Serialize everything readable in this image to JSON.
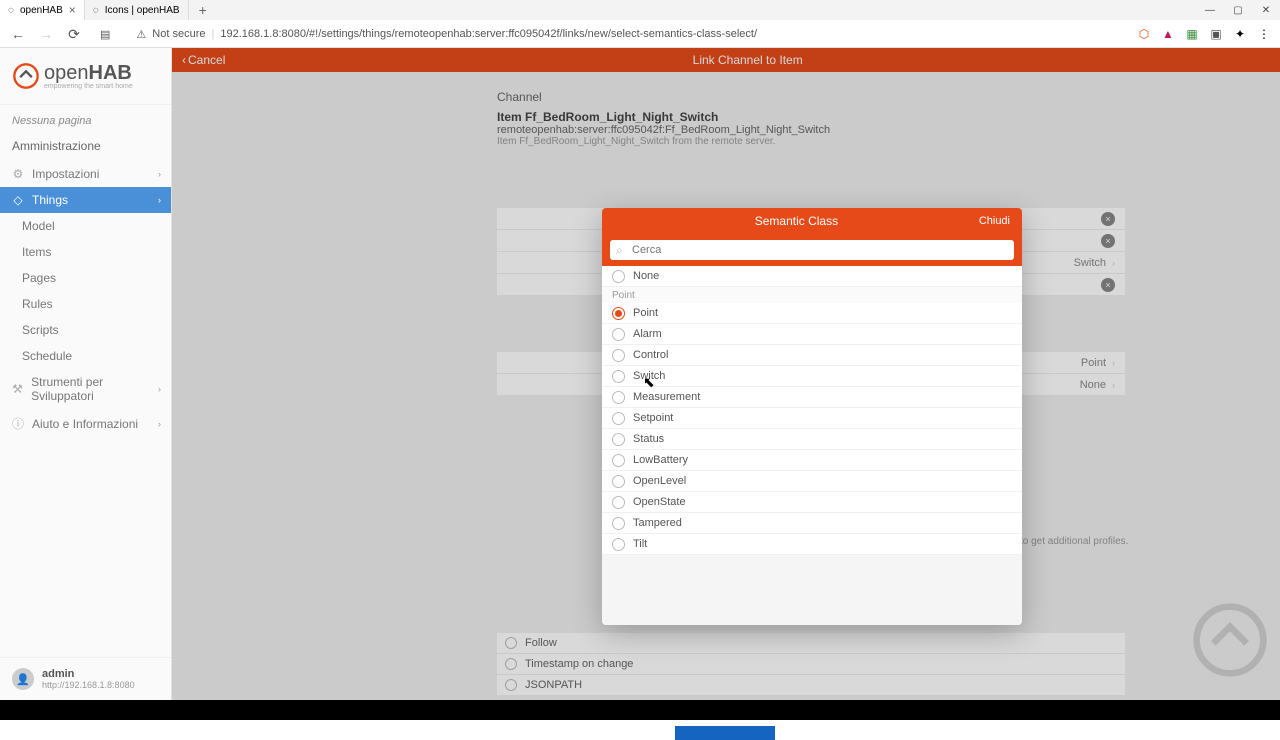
{
  "browser": {
    "tabs": [
      {
        "title": "openHAB",
        "active": true
      },
      {
        "title": "Icons | openHAB",
        "active": false
      }
    ],
    "security_label": "Not secure",
    "url": "192.168.1.8:8080/#!/settings/things/remoteopenhab:server:ffc095042f/links/new/select-semantics-class-select/"
  },
  "sidebar": {
    "brand_open": "open",
    "brand_hab": "HAB",
    "brand_sub": "empowering the smart home",
    "no_page": "Nessuna pagina",
    "admin": "Amministrazione",
    "items": [
      {
        "label": "Impostazioni",
        "icon": "⚙",
        "parent": true,
        "chev": true
      },
      {
        "label": "Things",
        "icon": "◇",
        "parent": true,
        "chev": true,
        "active": true
      },
      {
        "label": "Model",
        "icon": "▤"
      },
      {
        "label": "Items",
        "icon": "≡"
      },
      {
        "label": "Pages",
        "icon": "▭"
      },
      {
        "label": "Rules",
        "icon": "⋔"
      },
      {
        "label": "Scripts",
        "icon": "⟨⟩"
      },
      {
        "label": "Schedule",
        "icon": "☷"
      }
    ],
    "dev_tools": "Strumenti per Sviluppatori",
    "help": "Aiuto e Informazioni",
    "user": {
      "name": "admin",
      "url": "http://192.168.1.8:8080"
    }
  },
  "topbar": {
    "cancel": "Cancel",
    "title": "Link Channel to Item"
  },
  "channel": {
    "section": "Channel",
    "item": "Item Ff_BedRoom_Light_Night_Switch",
    "uid": "remoteopenhab:server:ffc095042f:Ff_BedRoom_Light_Night_Switch",
    "desc": "Item Ff_BedRoom_Light_Night_Switch from the remote server."
  },
  "bg_rows": [
    {
      "text": "",
      "clear": true
    },
    {
      "text": "",
      "clear": true
    },
    {
      "text": "Switch",
      "arrow": true
    },
    {
      "text": "",
      "clear": true
    },
    {
      "text": "Point",
      "arrow": true,
      "offset": 78
    },
    {
      "text": "None",
      "arrow": true,
      "offset": 21
    }
  ],
  "profile_note": "to get additional profiles.",
  "profile_options": [
    "Follow",
    "Timestamp on change",
    "JSONPATH"
  ],
  "modal": {
    "title": "Semantic Class",
    "close": "Chiudi",
    "search_placeholder": "Cerca",
    "none": "None",
    "group": "Point",
    "options": [
      {
        "label": "Point",
        "checked": true
      },
      {
        "label": "Alarm"
      },
      {
        "label": "Control"
      },
      {
        "label": "Switch"
      },
      {
        "label": "Measurement"
      },
      {
        "label": "Setpoint"
      },
      {
        "label": "Status"
      },
      {
        "label": "LowBattery"
      },
      {
        "label": "OpenLevel"
      },
      {
        "label": "OpenState"
      },
      {
        "label": "Tampered"
      },
      {
        "label": "Tilt"
      }
    ]
  }
}
